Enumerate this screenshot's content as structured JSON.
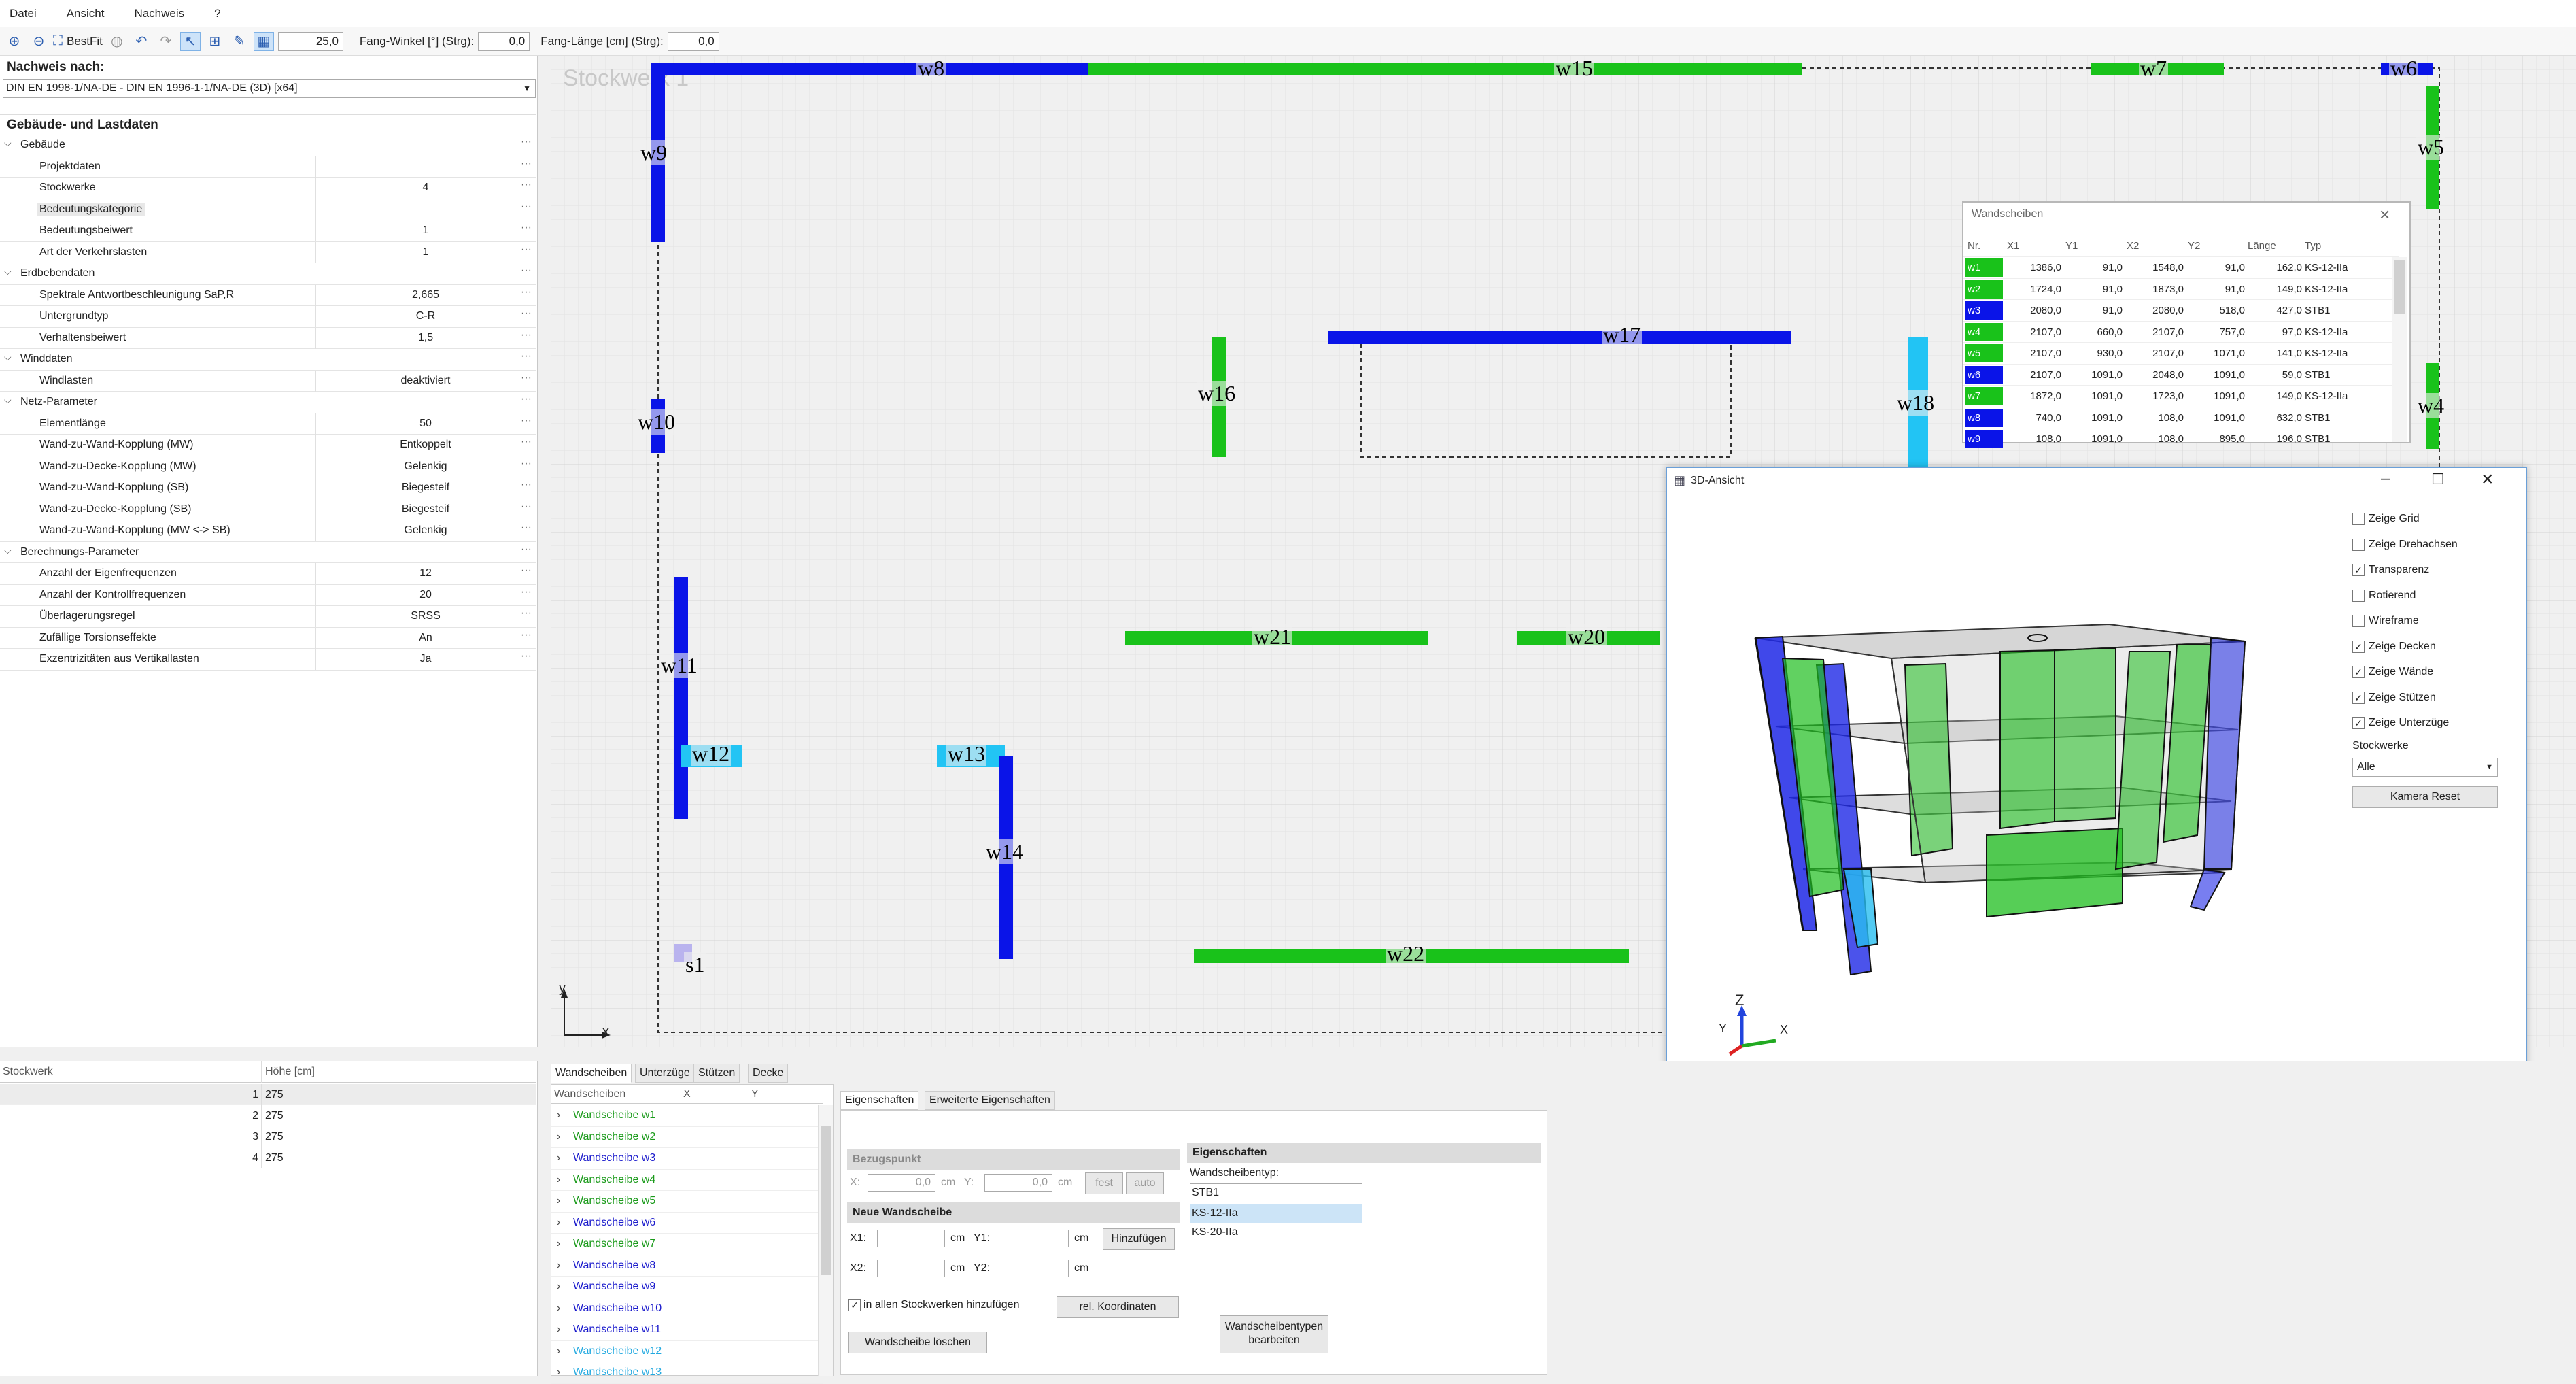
{
  "menu": [
    "Datei",
    "Ansicht",
    "Nachweis",
    "?"
  ],
  "toolbar": {
    "bestfit": "BestFit",
    "zoom_value": "25,0",
    "fang_winkel_label": "Fang-Winkel [°] (Strg):",
    "fang_winkel_value": "0,0",
    "fang_laenge_label": "Fang-Länge [cm] (Strg):",
    "fang_laenge_value": "0,0"
  },
  "left": {
    "nachweis_title": "Nachweis nach:",
    "nachweis_value": "DIN EN 1998-1/NA-DE - DIN EN 1996-1-1/NA-DE (3D) [x64]",
    "gebaeude_title": "Gebäude- und Lastdaten",
    "props": [
      {
        "cat": "Gebäude"
      },
      {
        "name": "Projektdaten",
        "value": ""
      },
      {
        "name": "Stockwerke",
        "value": "4"
      },
      {
        "name": "Bedeutungskategorie",
        "value": "",
        "selected": true
      },
      {
        "name": "Bedeutungsbeiwert",
        "value": "1"
      },
      {
        "name": "Art der Verkehrslasten",
        "value": "1"
      },
      {
        "cat": "Erdbebendaten"
      },
      {
        "name": "Spektrale Antwortbeschleunigung SaP,R",
        "value": "2,665"
      },
      {
        "name": "Untergrundtyp",
        "value": "C-R"
      },
      {
        "name": "Verhaltensbeiwert",
        "value": "1,5"
      },
      {
        "cat": "Winddaten"
      },
      {
        "name": "Windlasten",
        "value": "deaktiviert"
      },
      {
        "cat": "Netz-Parameter"
      },
      {
        "name": "Elementlänge",
        "value": "50"
      },
      {
        "name": "Wand-zu-Wand-Kopplung (MW)",
        "value": "Entkoppelt"
      },
      {
        "name": "Wand-zu-Decke-Kopplung (MW)",
        "value": "Gelenkig"
      },
      {
        "name": "Wand-zu-Wand-Kopplung (SB)",
        "value": "Biegesteif"
      },
      {
        "name": "Wand-zu-Decke-Kopplung (SB)",
        "value": "Biegesteif"
      },
      {
        "name": "Wand-zu-Wand-Kopplung (MW <-> SB)",
        "value": "Gelenkig"
      },
      {
        "cat": "Berechnungs-Parameter"
      },
      {
        "name": "Anzahl der Eigenfrequenzen",
        "value": "12"
      },
      {
        "name": "Anzahl der Kontrollfrequenzen",
        "value": "20"
      },
      {
        "name": "Überlagerungsregel",
        "value": "SRSS"
      },
      {
        "name": "Zufällige Torsionseffekte",
        "value": "An"
      },
      {
        "name": "Exzentrizitäten aus Vertikallasten",
        "value": "Ja"
      }
    ],
    "storey_table": {
      "headers": [
        "Stockwerk",
        "Höhe [cm]"
      ],
      "rows": [
        [
          "1",
          "275"
        ],
        [
          "2",
          "275"
        ],
        [
          "3",
          "275"
        ],
        [
          "4",
          "275"
        ]
      ]
    }
  },
  "canvas": {
    "storey_label": "Stockwerk 1",
    "axis_y": "y",
    "axis_x": "x",
    "walls": [
      {
        "id": "w8",
        "color": "blue"
      },
      {
        "id": "w15",
        "color": "green"
      },
      {
        "id": "w7",
        "color": "green"
      },
      {
        "id": "w6",
        "color": "blue"
      },
      {
        "id": "w9",
        "color": "blue"
      },
      {
        "id": "w5",
        "color": "green"
      },
      {
        "id": "w17",
        "color": "blue"
      },
      {
        "id": "w16",
        "color": "green"
      },
      {
        "id": "w18",
        "color": "cyan"
      },
      {
        "id": "w10",
        "color": "blue"
      },
      {
        "id": "w4",
        "color": "green"
      },
      {
        "id": "w21",
        "color": "green"
      },
      {
        "id": "w20",
        "color": "green"
      },
      {
        "id": "w11",
        "color": "blue"
      },
      {
        "id": "w12",
        "color": "cyan"
      },
      {
        "id": "w13",
        "color": "cyan"
      },
      {
        "id": "w14",
        "color": "blue"
      },
      {
        "id": "w22",
        "color": "green"
      },
      {
        "id": "s1",
        "color": "lavender"
      }
    ]
  },
  "wandscheiben_table": {
    "title": "Wandscheiben",
    "headers": [
      "Nr.",
      "X1",
      "Y1",
      "X2",
      "Y2",
      "Länge",
      "Typ"
    ],
    "rows": [
      [
        "w1",
        "1386,0",
        "91,0",
        "1548,0",
        "91,0",
        "162,0",
        "KS-12-IIa",
        "green"
      ],
      [
        "w2",
        "1724,0",
        "91,0",
        "1873,0",
        "91,0",
        "149,0",
        "KS-12-IIa",
        "green"
      ],
      [
        "w3",
        "2080,0",
        "91,0",
        "2080,0",
        "518,0",
        "427,0",
        "STB1",
        "blue"
      ],
      [
        "w4",
        "2107,0",
        "660,0",
        "2107,0",
        "757,0",
        "97,0",
        "KS-12-IIa",
        "green"
      ],
      [
        "w5",
        "2107,0",
        "930,0",
        "2107,0",
        "1071,0",
        "141,0",
        "KS-12-IIa",
        "green"
      ],
      [
        "w6",
        "2107,0",
        "1091,0",
        "2048,0",
        "1091,0",
        "59,0",
        "STB1",
        "blue"
      ],
      [
        "w7",
        "1872,0",
        "1091,0",
        "1723,0",
        "1091,0",
        "149,0",
        "KS-12-IIa",
        "green"
      ],
      [
        "w8",
        "740,0",
        "1091,0",
        "108,0",
        "1091,0",
        "632,0",
        "STB1",
        "blue"
      ],
      [
        "w9",
        "108,0",
        "1091,0",
        "108,0",
        "895,0",
        "196,0",
        "STB1",
        "blue"
      ]
    ]
  },
  "view3d": {
    "title": "3D-Ansicht",
    "options": [
      {
        "label": "Zeige Grid",
        "checked": false
      },
      {
        "label": "Zeige Drehachsen",
        "checked": false
      },
      {
        "label": "Transparenz",
        "checked": true
      },
      {
        "label": "Rotierend",
        "checked": false
      },
      {
        "label": "Wireframe",
        "checked": false
      },
      {
        "label": "Zeige Decken",
        "checked": true
      },
      {
        "label": "Zeige Wände",
        "checked": true
      },
      {
        "label": "Zeige Stützen",
        "checked": true
      },
      {
        "label": "Zeige Unterzüge",
        "checked": true
      }
    ],
    "stockwerke_label": "Stockwerke",
    "stockwerke_value": "Alle",
    "kamera_reset": "Kamera Reset",
    "axis_z": "Z",
    "axis_y": "Y",
    "axis_x": "X"
  },
  "bottom": {
    "tabs": [
      "Wandscheiben",
      "Unterzüge",
      "Stützen",
      "Decke"
    ],
    "list_headers": [
      "Wandscheiben",
      "X",
      "Y"
    ],
    "list_items": [
      {
        "name": "Wandscheibe w1",
        "color": "#1a9a1a"
      },
      {
        "name": "Wandscheibe w2",
        "color": "#1a9a1a"
      },
      {
        "name": "Wandscheibe w3",
        "color": "#1a1acc"
      },
      {
        "name": "Wandscheibe w4",
        "color": "#1a9a1a"
      },
      {
        "name": "Wandscheibe w5",
        "color": "#1a9a1a"
      },
      {
        "name": "Wandscheibe w6",
        "color": "#1a1acc"
      },
      {
        "name": "Wandscheibe w7",
        "color": "#1a9a1a"
      },
      {
        "name": "Wandscheibe w8",
        "color": "#1a1acc"
      },
      {
        "name": "Wandscheibe w9",
        "color": "#1a1acc"
      },
      {
        "name": "Wandscheibe w10",
        "color": "#1a1acc"
      },
      {
        "name": "Wandscheibe w11",
        "color": "#1a1acc"
      },
      {
        "name": "Wandscheibe w12",
        "color": "#22a9e0"
      },
      {
        "name": "Wandscheibe w13",
        "color": "#22a9e0"
      }
    ],
    "props_tabs": [
      "Eigenschaften",
      "Erweiterte Eigenschaften"
    ],
    "bezugspunkt": "Bezugspunkt",
    "x_label": "X:",
    "y_label": "Y:",
    "x_value": "0,0",
    "y_value": "0,0",
    "cm": "cm",
    "fest": "fest",
    "auto": "auto",
    "neue_wandscheibe": "Neue Wandscheibe",
    "x1": "X1:",
    "y1": "Y1:",
    "x2": "X2:",
    "y2": "Y2:",
    "hinzufuegen": "Hinzufügen",
    "in_allen": "in allen Stockwerken hinzufügen",
    "rel_koord": "rel. Koordinaten",
    "loeschen": "Wandscheibe löschen",
    "eigenschaften": "Eigenschaften",
    "wandscheibentyp": "Wandscheibentyp:",
    "typen": [
      "STB1",
      "KS-12-IIa",
      "KS-20-IIa"
    ],
    "typen_bearbeiten": "Wandscheibentypen bearbeiten"
  }
}
